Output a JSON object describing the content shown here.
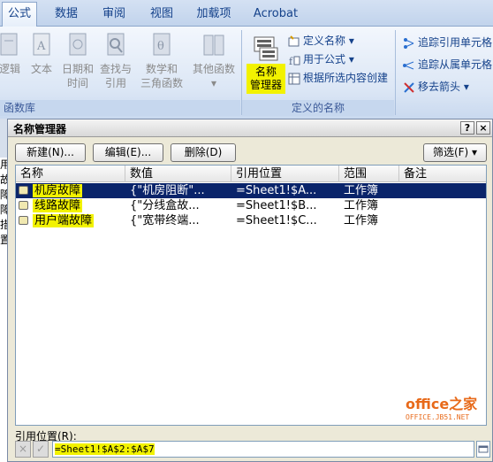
{
  "tabs": [
    "公式",
    "数据",
    "审阅",
    "视图",
    "加载项",
    "Acrobat"
  ],
  "ribbon": {
    "function_library": {
      "items": [
        {
          "label": "逻辑",
          "icon": "logic-icon"
        },
        {
          "label": "文本",
          "icon": "text-icon"
        },
        {
          "label": "日期和时间",
          "line1": "日期和",
          "line2": "时间",
          "icon": "date-time-icon"
        },
        {
          "label": "查找与引用",
          "line1": "查找与",
          "line2": "引用",
          "icon": "lookup-icon"
        },
        {
          "label": "数学和三角函数",
          "line1": "数学和",
          "line2": "三角函数",
          "icon": "math-icon"
        },
        {
          "label": "其他函数",
          "line1": "其他函数",
          "line2": "",
          "icon": "more-functions-icon"
        }
      ],
      "group_label": "函数库"
    },
    "defined_names": {
      "name_manager_line1": "名称",
      "name_manager_line2": "管理器",
      "define_name": "定义名称",
      "use_in_formula": "用于公式",
      "create_from_selection": "根据所选内容创建",
      "group_label": "定义的名称"
    },
    "formula_auditing": {
      "trace_precedents": "追踪引用单元格",
      "trace_dependents": "追踪从属单元格",
      "remove_arrows": "移去箭头"
    }
  },
  "sheet_strip": [
    "用",
    "故",
    "障",
    "障",
    "措",
    "置"
  ],
  "dialog": {
    "title": "名称管理器",
    "help": "?",
    "close": "×",
    "buttons": {
      "new": "新建(N)...",
      "edit": "编辑(E)...",
      "delete": "删除(D)",
      "filter": "筛选(F)"
    },
    "columns": [
      "名称",
      "数值",
      "引用位置",
      "范围",
      "备注"
    ],
    "rows": [
      {
        "name": "机房故障",
        "value": "{\"机房阻断\"...",
        "refers_to": "=Sheet1!$A...",
        "scope": "工作簿",
        "comment": ""
      },
      {
        "name": "线路故障",
        "value": "{\"分线盒故...",
        "refers_to": "=Sheet1!$B...",
        "scope": "工作簿",
        "comment": ""
      },
      {
        "name": "用户端故障",
        "value": "{\"宽带终端...",
        "refers_to": "=Sheet1!$C...",
        "scope": "工作簿",
        "comment": ""
      }
    ],
    "ref_label": "引用位置(R):",
    "ref_value": "=Sheet1!$A$2:$A$7",
    "cancel_icon": "×",
    "ok_icon": "✓"
  },
  "watermark": {
    "line1": "office之家",
    "line2": "OFFICE.JB51.NET"
  },
  "colors": {
    "highlight": "#f2f200",
    "selection": "#0a246a",
    "ribbon_text": "#15428b"
  }
}
